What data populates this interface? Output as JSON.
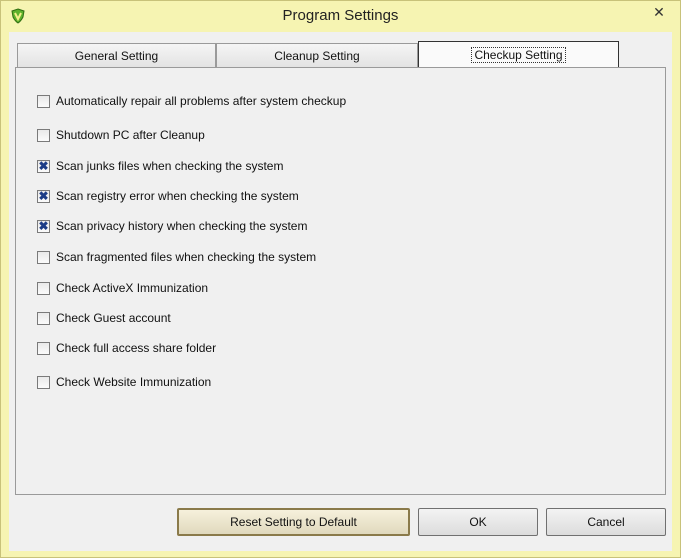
{
  "window": {
    "title": "Program Settings",
    "close_glyph": "✕"
  },
  "tabs": [
    {
      "label": "General Setting",
      "active": false
    },
    {
      "label": "Cleanup Setting",
      "active": false
    },
    {
      "label": "Checkup Setting",
      "active": true
    }
  ],
  "options": [
    {
      "label": "Automatically repair all problems after system checkup",
      "checked": false
    },
    {
      "label": "Shutdown PC after Cleanup",
      "checked": false
    },
    {
      "label": "Scan junks files when checking the system",
      "checked": true
    },
    {
      "label": "Scan registry error when checking the system",
      "checked": true
    },
    {
      "label": "Scan privacy history when checking the system",
      "checked": true
    },
    {
      "label": "Scan fragmented files when checking the system",
      "checked": false
    },
    {
      "label": "Check ActiveX Immunization",
      "checked": false
    },
    {
      "label": "Check Guest account",
      "checked": false
    },
    {
      "label": "Check full access share folder",
      "checked": false
    },
    {
      "label": "Check Website Immunization",
      "checked": false
    }
  ],
  "buttons": {
    "reset": "Reset Setting to Default",
    "ok": "OK",
    "cancel": "Cancel"
  },
  "colors": {
    "titlebar": "#f6f4b2",
    "check_mark": "#1c3c86"
  },
  "icons": {
    "app": "shield-icon",
    "close": "close-icon",
    "check": "check-icon"
  }
}
